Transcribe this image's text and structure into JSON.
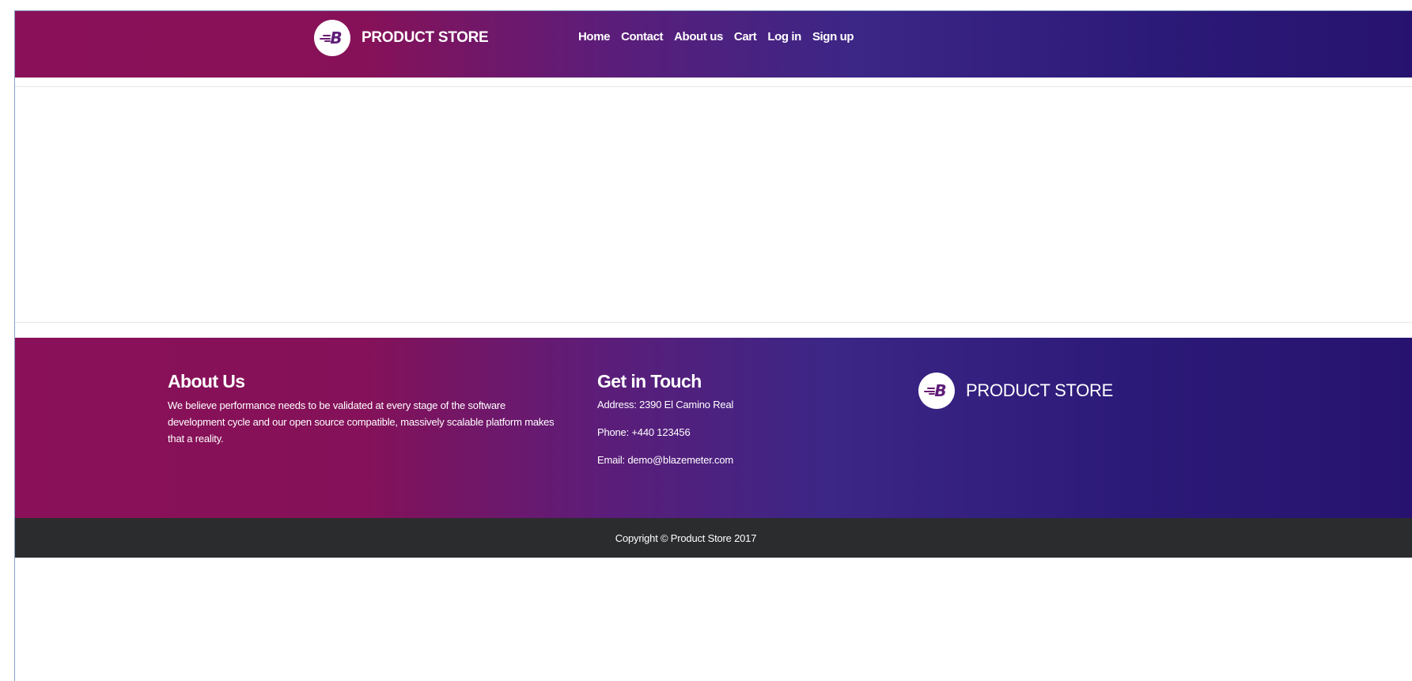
{
  "navbar": {
    "brand_logo_letter": "B",
    "brand_name": "PRODUCT STORE",
    "links": [
      "Home",
      "Contact",
      "About us",
      "Cart",
      "Log in",
      "Sign up"
    ]
  },
  "footer": {
    "about": {
      "heading": "About Us",
      "text": "We believe performance needs to be validated at every stage of the software development cycle and our open source compatible, massively scalable platform makes that a reality."
    },
    "contact": {
      "heading": "Get in Touch",
      "address": "Address: 2390 El Camino Real",
      "phone": "Phone: +440 123456",
      "email": "Email: demo@blazemeter.com"
    },
    "brand_logo_letter": "B",
    "brand_name": "PRODUCT STORE"
  },
  "copyright": "Copyright © Product Store 2017",
  "colors": {
    "gradient_start": "#8a1159",
    "gradient_end": "#27136f",
    "copyright_bg": "#2b2c2e"
  }
}
